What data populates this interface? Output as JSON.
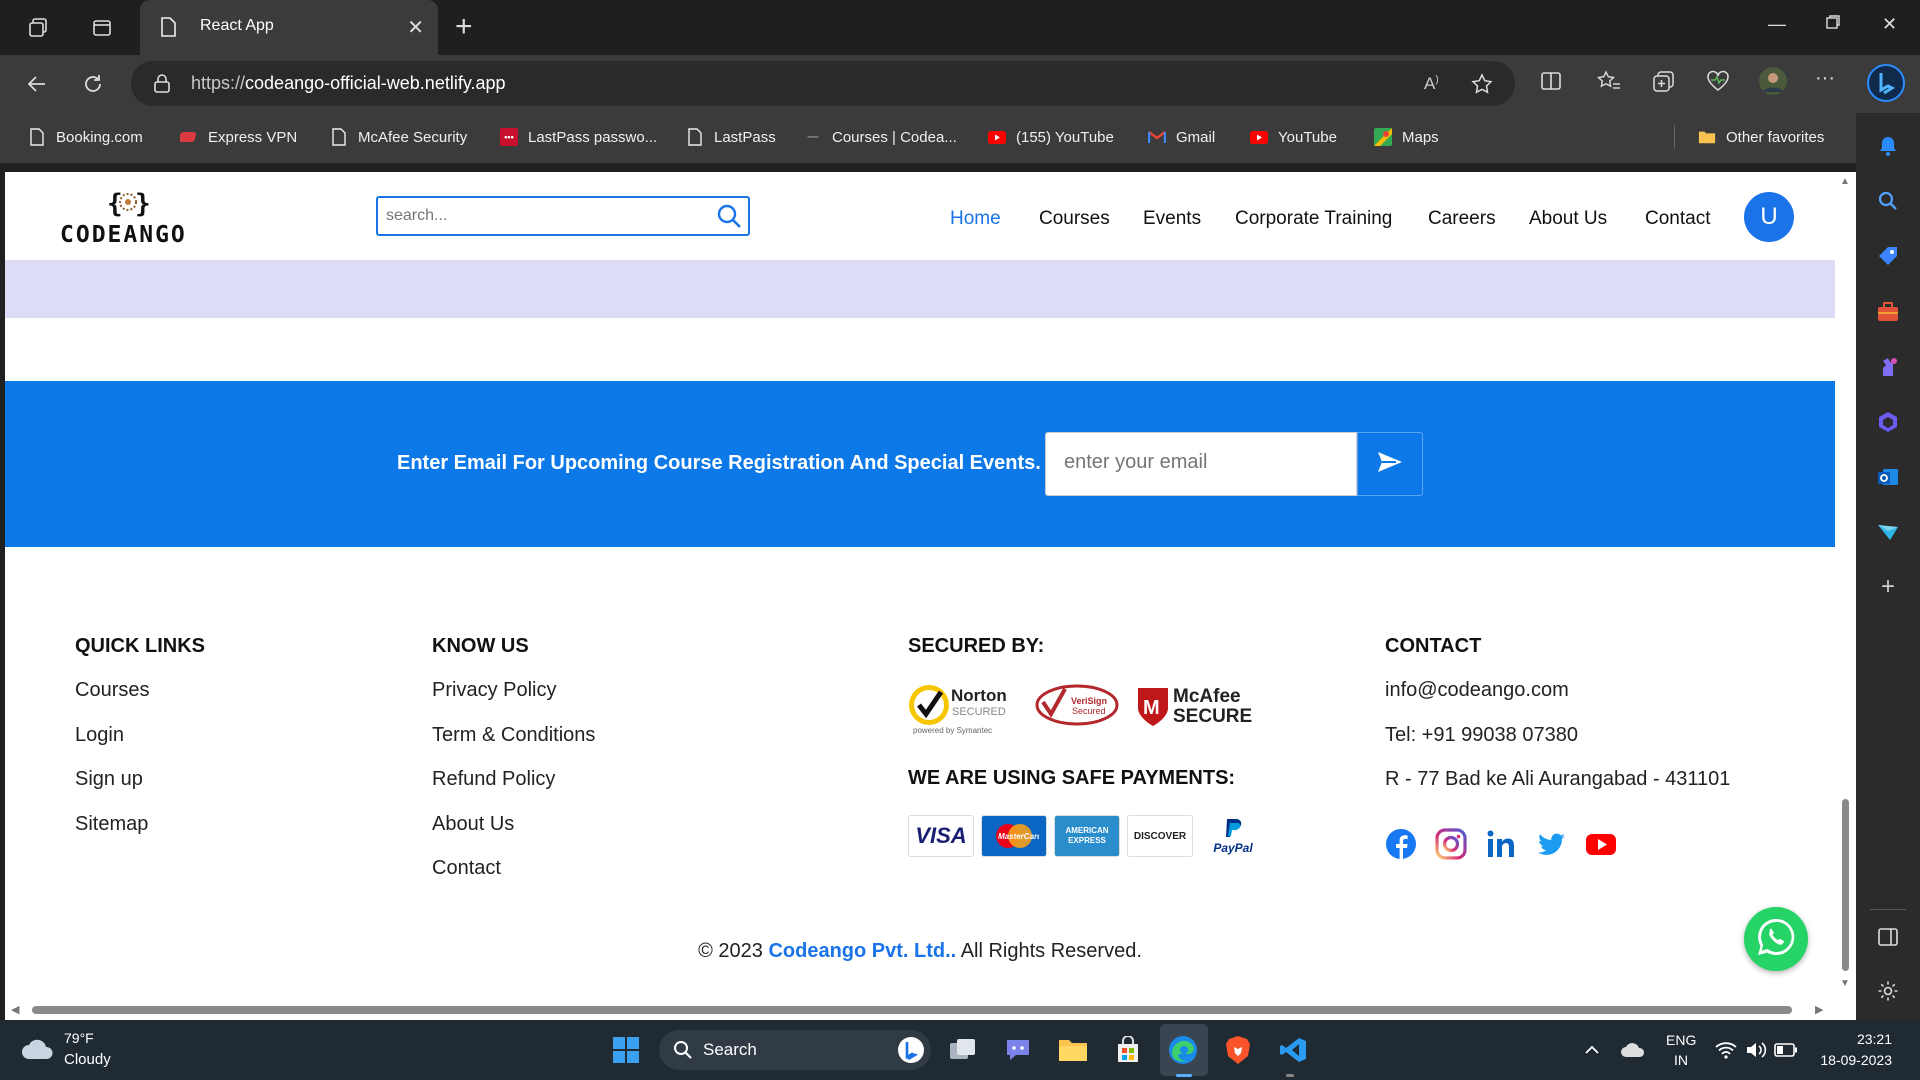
{
  "browser": {
    "tab_title": "React App",
    "url_scheme": "https://",
    "url_host": "codeango-official-web.netlify.app",
    "favorites": [
      {
        "label": "Booking.com"
      },
      {
        "label": "Express VPN"
      },
      {
        "label": "McAfee Security"
      },
      {
        "label": "LastPass passwo..."
      },
      {
        "label": "LastPass"
      },
      {
        "label": "Courses | Codea..."
      },
      {
        "label": "(155) YouTube"
      },
      {
        "label": "Gmail"
      },
      {
        "label": "YouTube"
      },
      {
        "label": "Maps"
      }
    ],
    "other_favorites": "Other favorites"
  },
  "site": {
    "logo_text": "CODEANGO",
    "search_placeholder": "search...",
    "nav": [
      "Home",
      "Courses",
      "Events",
      "Corporate Training",
      "Careers",
      "About Us",
      "Contact"
    ],
    "active_nav": "Home",
    "user_initial": "U",
    "newsletter": {
      "text": "Enter Email For Upcoming Course Registration And Special Events.",
      "placeholder": "enter your email"
    },
    "footer": {
      "quick_links_title": "QUICK LINKS",
      "quick_links": [
        "Courses",
        "Login",
        "Sign up",
        "Sitemap"
      ],
      "know_us_title": "KNOW US",
      "know_us": [
        "Privacy Policy",
        "Term & Conditions",
        "Refund Policy",
        "About Us",
        "Contact"
      ],
      "secured_title": "SECURED BY:",
      "secured_badges": [
        "Norton SECURED",
        "VeriSign Secured",
        "McAfee SECURE"
      ],
      "payments_title": "WE ARE USING SAFE PAYMENTS:",
      "payments": [
        "VISA",
        "MasterCard",
        "AMERICAN EXPRESS",
        "DISCOVER",
        "PayPal"
      ],
      "contact_title": "CONTACT",
      "contact_email": "info@codeango.com",
      "contact_phone": "Tel: +91 99038 07380",
      "contact_address": "R - 77 Bad ke Ali Aurangabad - 431101",
      "social": [
        "facebook-icon",
        "instagram-icon",
        "linkedin-icon",
        "twitter-icon",
        "youtube-icon"
      ],
      "copyright_prefix": "© 2023 ",
      "copyright_brand": "Codeango Pvt. Ltd..",
      "copyright_suffix": " All Rights Reserved."
    }
  },
  "colors": {
    "brand_blue": "#1a73e8",
    "newsletter_bg": "#0d79e8",
    "lavender": "#dcdcf7"
  },
  "taskbar": {
    "temperature": "79°F",
    "condition": "Cloudy",
    "search_label": "Search",
    "lang_primary": "ENG",
    "lang_secondary": "IN",
    "time": "23:21",
    "date": "18-09-2023"
  }
}
